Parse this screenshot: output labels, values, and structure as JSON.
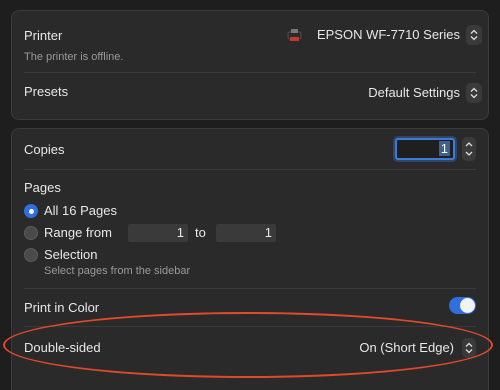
{
  "printer": {
    "label": "Printer",
    "name": "EPSON WF-7710 Series",
    "status": "The printer is offline."
  },
  "presets": {
    "label": "Presets",
    "value": "Default Settings"
  },
  "copies": {
    "label": "Copies",
    "value": "1"
  },
  "pages": {
    "label": "Pages",
    "options": {
      "all": "All 16 Pages",
      "range": "Range from",
      "range_to": "to",
      "range_from_value": "1",
      "range_to_value": "1",
      "selection": "Selection",
      "selection_hint": "Select pages from the sidebar"
    },
    "selected": "all"
  },
  "print_in_color": {
    "label": "Print in Color",
    "enabled": true
  },
  "double_sided": {
    "label": "Double-sided",
    "value": "On (Short Edge)"
  },
  "icons": {
    "printer": "printer-icon",
    "stepper": "up-down-chevron-icon"
  },
  "colors": {
    "accent": "#2f6fde",
    "annotation": "#e04a2a"
  }
}
